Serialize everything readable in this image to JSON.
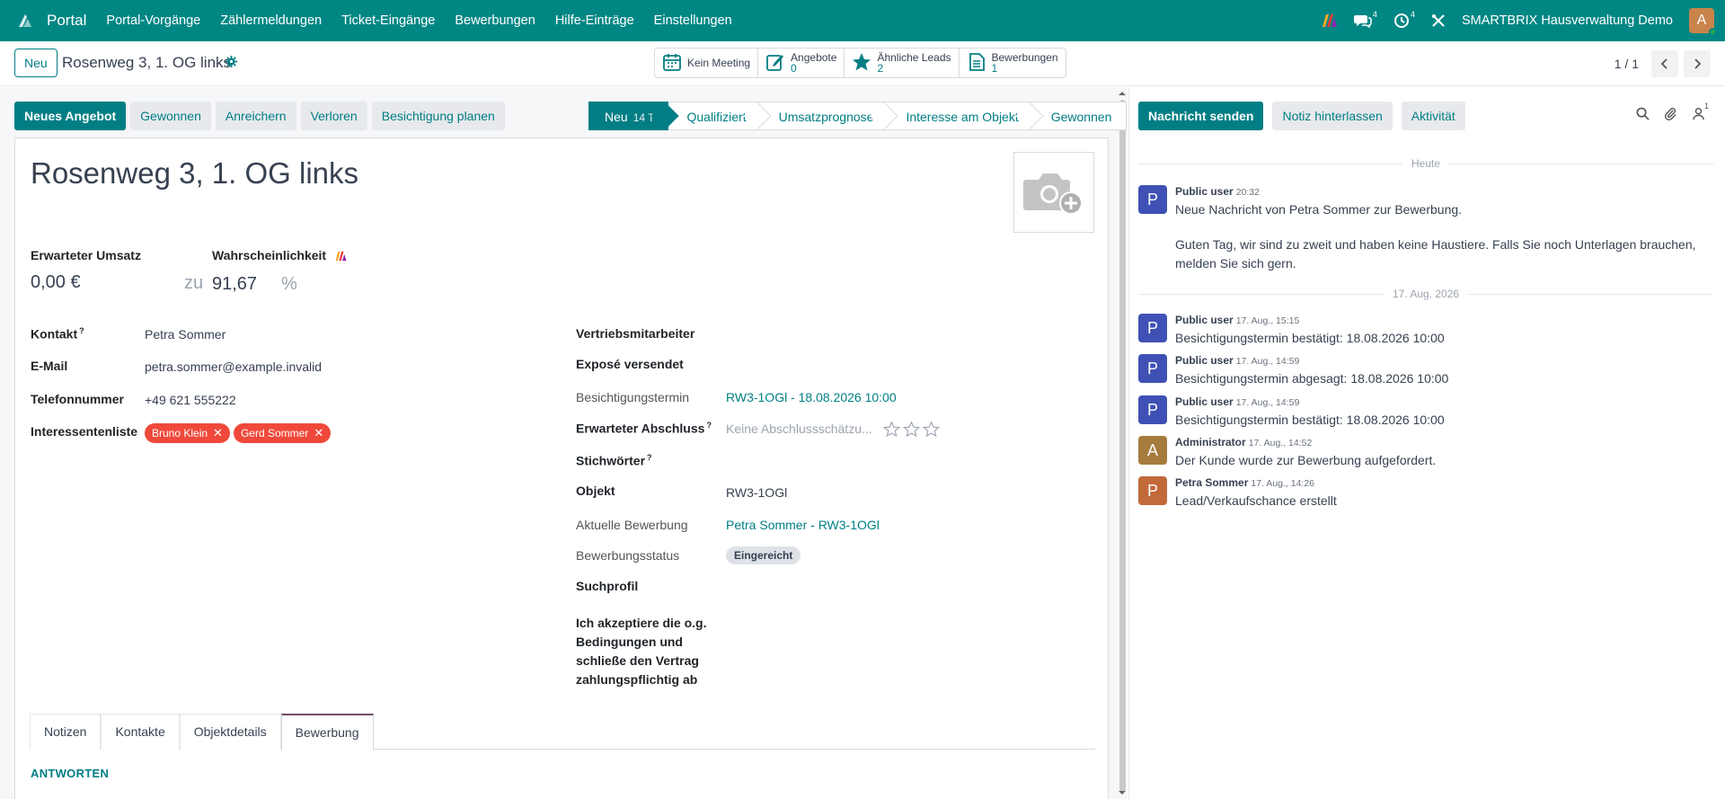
{
  "navbar": {
    "brand": "Portal",
    "items": [
      "Portal-Vorgänge",
      "Zählermeldungen",
      "Ticket-Eingänge",
      "Bewerbungen",
      "Hilfe-Einträge",
      "Einstellungen"
    ],
    "messages_count": "4",
    "activities_count": "4",
    "company": "SMARTBRIX Hausverwaltung Demo",
    "user_initial": "A"
  },
  "control_panel": {
    "new_label": "Neu",
    "record_title": "Rosenweg 3, 1. OG links",
    "smart_buttons": {
      "meeting": "Kein Meeting",
      "offers_label": "Angebote",
      "offers_value": "0",
      "similar_label": "Ähnliche Leads",
      "similar_value": "2",
      "applications_label": "Bewerbungen",
      "applications_value": "1"
    },
    "pager": "1 / 1"
  },
  "statusbar": {
    "buttons": [
      "Neues Angebot",
      "Gewonnen",
      "Anreichern",
      "Verloren",
      "Besichtigung planen"
    ],
    "stages": [
      {
        "label": "Neu",
        "badge": "14 T"
      },
      {
        "label": "Qualifiziert"
      },
      {
        "label": "Umsatzprognose"
      },
      {
        "label": "Interesse am Objekt"
      },
      {
        "label": "Gewonnen"
      }
    ]
  },
  "form": {
    "title": "Rosenweg 3, 1. OG links",
    "expected_revenue_label": "Erwarteter Umsatz",
    "expected_revenue": "0,00 €",
    "probability_label": "Wahrscheinlichkeit",
    "zu": "zu",
    "probability": "91,67",
    "percent": "%",
    "left": {
      "contact_label": "Kontakt",
      "contact": "Petra Sommer",
      "email_label": "E-Mail",
      "email": "petra.sommer@example.invalid",
      "phone_label": "Telefonnummer",
      "phone": "+49 621 555222",
      "interest_label": "Interessentenliste",
      "tags": [
        "Bruno Klein",
        "Gerd Sommer"
      ]
    },
    "right": {
      "salesperson_label": "Vertriebsmitarbeiter",
      "expose_label": "Exposé versendet",
      "viewing_label": "Besichtigungstermin",
      "viewing": "RW3-1OGl - 18.08.2026 10:00",
      "close_label": "Erwarteter Abschluss",
      "close_placeholder": "Keine Abschlussschätzu...",
      "keywords_label": "Stichwörter",
      "object_label": "Objekt",
      "object": "RW3-1OGl",
      "application_label": "Aktuelle Bewerbung",
      "application": "Petra Sommer - RW3-1OGl",
      "status_label": "Bewerbungsstatus",
      "status": "Eingereicht",
      "search_profile_label": "Suchprofil",
      "accept_label_1": "Ich akzeptiere die o.g.",
      "accept_label_2": "Bedingungen und",
      "accept_label_3": "schließe den Vertrag",
      "accept_label_4": "zahlungspflichtig ab"
    },
    "question_mark": "?",
    "tabs": [
      "Notizen",
      "Kontakte",
      "Objektdetails",
      "Bewerbung"
    ],
    "active_tab": "Bewerbung",
    "section_heading": "ANTWORTEN"
  },
  "chatter": {
    "buttons": [
      "Nachricht senden",
      "Notiz hinterlassen",
      "Aktivität"
    ],
    "followers_count": "1",
    "sep_today": "Heute",
    "sep_date": "17. Aug. 2026",
    "messages": [
      {
        "initial": "P",
        "author": "Public user",
        "date": "20:32",
        "lines": [
          "Neue Nachricht von Petra Sommer zur Bewerbung.",
          "",
          "Guten Tag, wir sind zu zweit und haben keine Haustiere. Falls Sie noch Unterlagen brauchen,",
          "melden Sie sich gern."
        ],
        "color": "#3f51b5"
      },
      {
        "initial": "P",
        "author": "Public user",
        "date": "17. Aug., 15:15",
        "lines": [
          "Besichtigungstermin bestätigt: 18.08.2026 10:00"
        ],
        "color": "#3f51b5"
      },
      {
        "initial": "P",
        "author": "Public user",
        "date": "17. Aug., 14:59",
        "lines": [
          "Besichtigungstermin abgesagt: 18.08.2026 10:00"
        ],
        "color": "#3f51b5"
      },
      {
        "initial": "P",
        "author": "Public user",
        "date": "17. Aug., 14:59",
        "lines": [
          "Besichtigungstermin bestätigt: 18.08.2026 10:00"
        ],
        "color": "#3f51b5"
      },
      {
        "initial": "A",
        "author": "Administrator",
        "date": "17. Aug., 14:52",
        "lines": [
          "Der Kunde wurde zur Bewerbung aufgefordert."
        ],
        "color": "#a67c3d"
      },
      {
        "initial": "P",
        "author": "Petra Sommer",
        "date": "17. Aug., 14:26",
        "lines": [
          "Lead/Verkaufschance erstellt"
        ],
        "color": "#c26a3a"
      }
    ]
  },
  "colors": {
    "brand": "#008784",
    "accent": "#017e84",
    "tag": "#f0493b",
    "active_tab_border": "#714b67"
  }
}
